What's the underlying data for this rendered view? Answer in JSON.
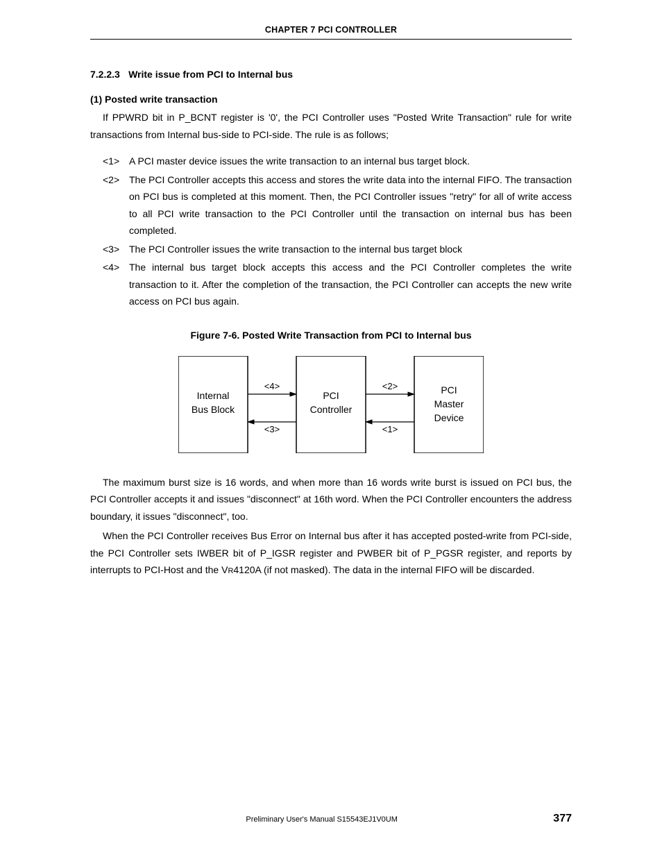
{
  "chapter_header": "CHAPTER  7   PCI CONTROLLER",
  "section_number": "7.2.2.3",
  "section_title": "Write issue from PCI to Internal bus",
  "subsection_label": "(1) Posted write transaction",
  "intro_para": "If PPWRD bit in P_BCNT register is '0', the PCI Controller uses \"Posted Write Transaction\" rule for write transactions from Internal bus-side to PCI-side. The rule is as follows;",
  "steps": [
    {
      "label": "<1>",
      "text": "A PCI master device issues the write transaction to an internal bus target block."
    },
    {
      "label": "<2>",
      "text": "The PCI Controller accepts this access and stores the write data into the internal FIFO. The transaction on PCI bus is completed at this moment. Then, the PCI Controller issues \"retry\" for all of write access to all PCI write transaction to the PCI Controller until the transaction on internal bus has been completed."
    },
    {
      "label": "<3>",
      "text": "The PCI Controller issues the write transaction to the internal bus target block"
    },
    {
      "label": "<4>",
      "text": "The internal bus target block accepts this access and the PCI Controller completes the write transaction to it. After the completion of the transaction, the PCI Controller can accepts the new write access on PCI bus again."
    }
  ],
  "figure_caption": "Figure 7-6.  Posted Write Transaction from PCI to Internal bus",
  "diagram": {
    "box_left_line1": "Internal",
    "box_left_line2": "Bus Block",
    "box_mid_line1": "PCI",
    "box_mid_line2": "Controller",
    "box_right_line1": "PCI",
    "box_right_line2": "Master",
    "box_right_line3": "Device",
    "arrow_top_left": "<4>",
    "arrow_bot_left": "<3>",
    "arrow_top_right": "<2>",
    "arrow_bot_right": "<1>"
  },
  "para_burst": "The maximum burst size is 16 words, and when more than 16 words write burst is issued on PCI bus, the PCI Controller accepts it and issues \"disconnect\" at 16th word. When the PCI Controller encounters the address boundary, it issues \"disconnect\", too.",
  "para_err_prefix": "When the PCI Controller receives Bus Error on Internal bus after it has accepted posted-write from PCI-side, the PCI Controller sets IWBER bit of P_IGSR register and PWBER bit of P_PGSR register, and reports by interrupts to PCI-Host and the V",
  "para_err_sc": "R",
  "para_err_suffix": "4120A (if not masked). The data in the internal FIFO will be discarded.",
  "footer_center": "Preliminary User's Manual  S15543EJ1V0UM",
  "footer_page": "377"
}
